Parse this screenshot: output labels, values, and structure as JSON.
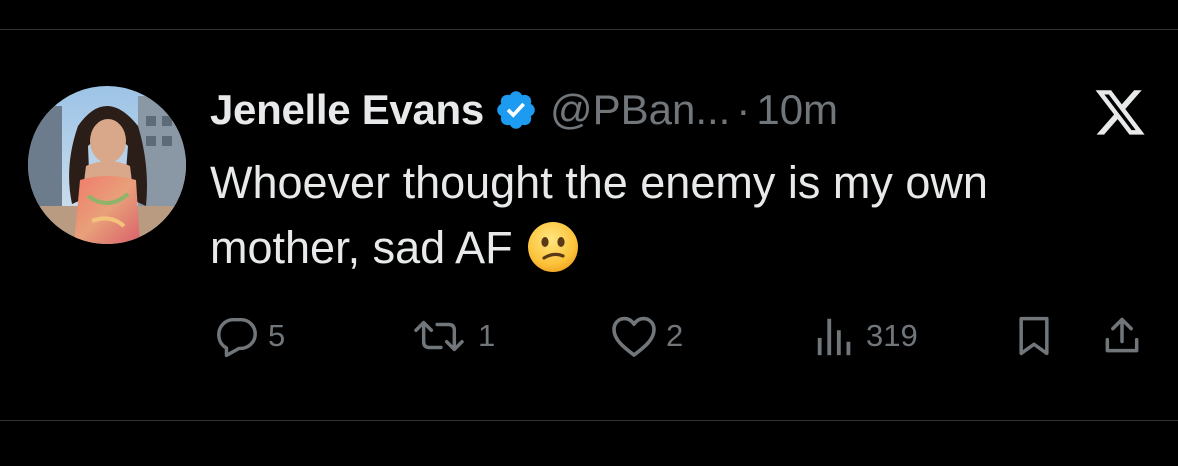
{
  "tweet": {
    "author": {
      "display_name": "Jenelle Evans",
      "handle": "@PBan...",
      "verified": true
    },
    "separator": "·",
    "timestamp": "10m",
    "text_lines": [
      "Whoever thought the enemy is my own",
      "mother, sad AF"
    ],
    "emoji": "confused-face",
    "stats": {
      "replies": "5",
      "reposts": "1",
      "likes": "2",
      "views": "319"
    }
  },
  "colors": {
    "background": "#000000",
    "text": "#e7e9ea",
    "muted": "#71767b",
    "verified_blue": "#1d9bf0",
    "divider": "#2f3336"
  },
  "icons": {
    "brand": "x-logo-icon",
    "reply": "reply-icon",
    "repost": "repost-icon",
    "like": "heart-icon",
    "views": "views-chart-icon",
    "bookmark": "bookmark-icon",
    "share": "share-icon"
  }
}
